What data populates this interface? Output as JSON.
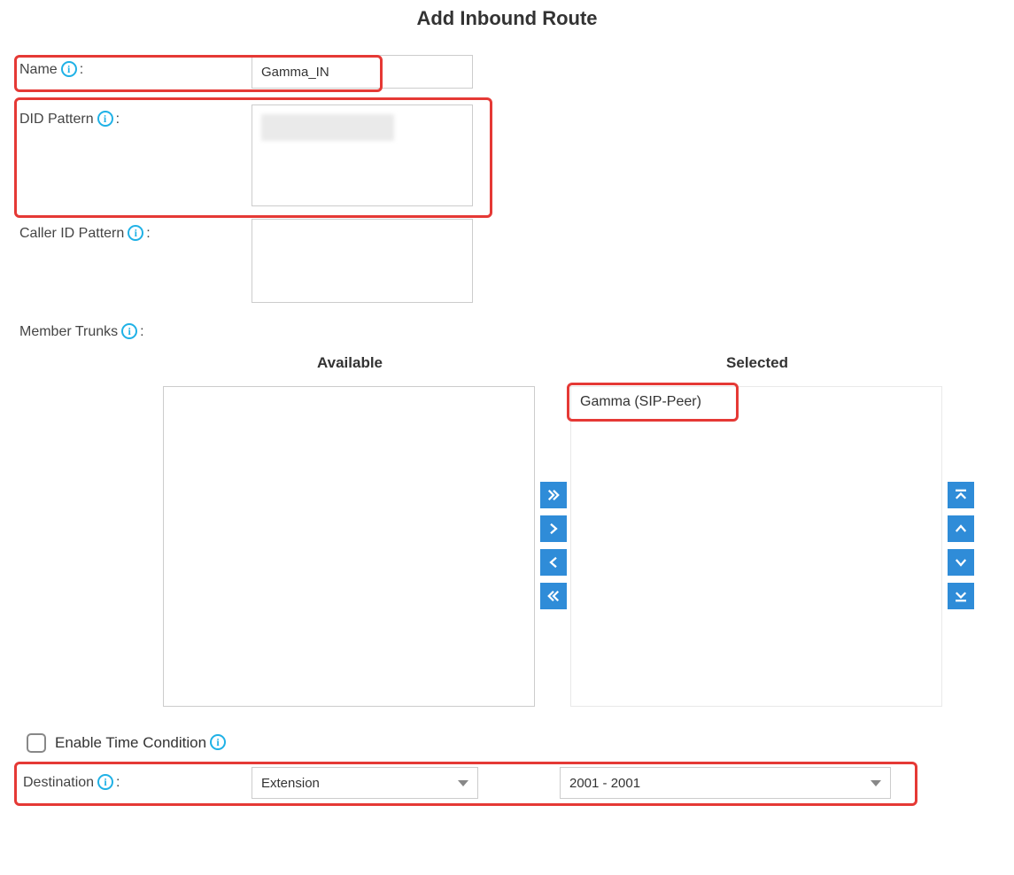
{
  "title": "Add Inbound Route",
  "labels": {
    "name": "Name",
    "did_pattern": "DID Pattern",
    "caller_id_pattern": "Caller ID Pattern",
    "member_trunks": "Member Trunks",
    "available": "Available",
    "selected": "Selected",
    "enable_time_condition": "Enable Time Condition",
    "destination": "Destination"
  },
  "fields": {
    "name_value": "Gamma_IN",
    "did_pattern_value": "",
    "caller_id_pattern_value": ""
  },
  "trunks": {
    "available": [],
    "selected": [
      "Gamma (SIP-Peer)"
    ]
  },
  "time_condition_enabled": false,
  "destination": {
    "type": "Extension",
    "value": "2001 - 2001"
  }
}
